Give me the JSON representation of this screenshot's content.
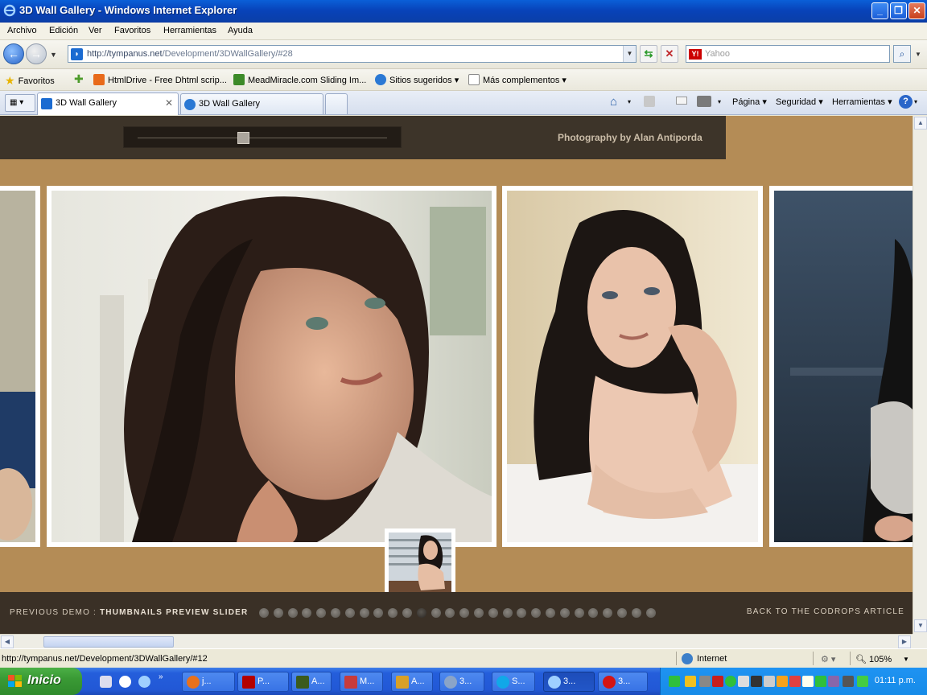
{
  "window": {
    "title": "3D Wall Gallery - Windows Internet Explorer"
  },
  "menu": [
    "Archivo",
    "Edición",
    "Ver",
    "Favoritos",
    "Herramientas",
    "Ayuda"
  ],
  "address": {
    "url_domain": "http://tympanus.net",
    "url_path": "/Development/3DWallGallery/#28",
    "search_placeholder": "Yahoo"
  },
  "favorites_bar": {
    "label": "Favoritos",
    "items": [
      "HtmlDrive - Free Dhtml scrip...",
      "MeadMiracle.com Sliding Im...",
      "Sitios sugeridos",
      "Más complementos"
    ]
  },
  "tabs": [
    {
      "label": "3D Wall Gallery"
    },
    {
      "label": "3D Wall Gallery"
    }
  ],
  "command_bar": {
    "pagina": "Página",
    "seguridad": "Seguridad",
    "herramientas": "Herramientas"
  },
  "gallery": {
    "credit": "Photography by Alan Antiporda",
    "prev_demo_label": "PREVIOUS DEMO :",
    "prev_demo_title": "THUMBNAILS PREVIEW SLIDER",
    "back_link": "BACK TO THE CODROPS ARTICLE",
    "dot_count": 28,
    "active_dot": 11,
    "slider_position": 0.42
  },
  "status": {
    "url": "http://tympanus.net/Development/3DWallGallery/#12",
    "zone": "Internet",
    "zoom": "105%"
  },
  "taskbar": {
    "start": "Inicio",
    "tasks": [
      "j...",
      "P...",
      "A...",
      "M...",
      "A...",
      "3...",
      "S...",
      "3...",
      "3..."
    ],
    "clock": "01:11 p.m."
  },
  "colors": {
    "gallery_bg": "#b48c56",
    "gallery_dark": "#3a3026",
    "xp_blue": "#245edb"
  }
}
